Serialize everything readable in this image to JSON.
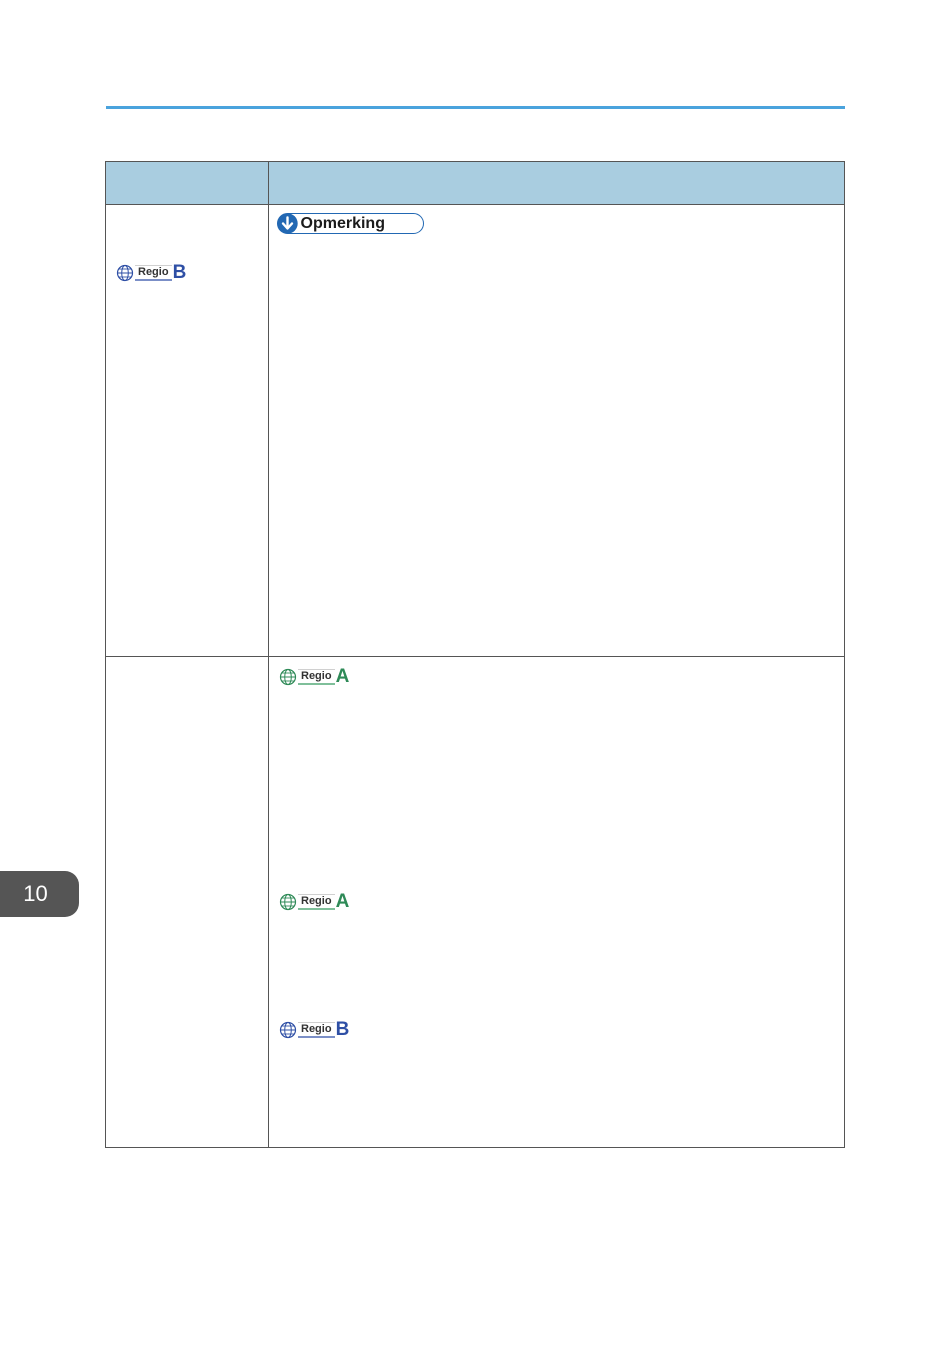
{
  "header": {
    "col1_label": "",
    "col2_label": ""
  },
  "rows": [
    {
      "left_badges": [
        {
          "word": "Regio",
          "letter": "B"
        }
      ],
      "note": {
        "label": "Opmerking"
      },
      "right_badges": []
    },
    {
      "left_badges": [],
      "right_badges": [
        {
          "word": "Regio",
          "letter": "A"
        },
        {
          "word": "Regio",
          "letter": "A"
        },
        {
          "word": "Regio",
          "letter": "B"
        }
      ]
    }
  ],
  "chapter_tab": {
    "number": "10"
  },
  "colors": {
    "top_rule": "#4aa3dd",
    "table_header": "#a9cde0",
    "regio_b": "#2e4fa5",
    "regio_a": "#2e8a57",
    "note_border": "#2268b3",
    "chapter_tab": "#555555"
  },
  "icons": {
    "region": "globe-icon",
    "note": "down-arrow-circle-icon"
  }
}
